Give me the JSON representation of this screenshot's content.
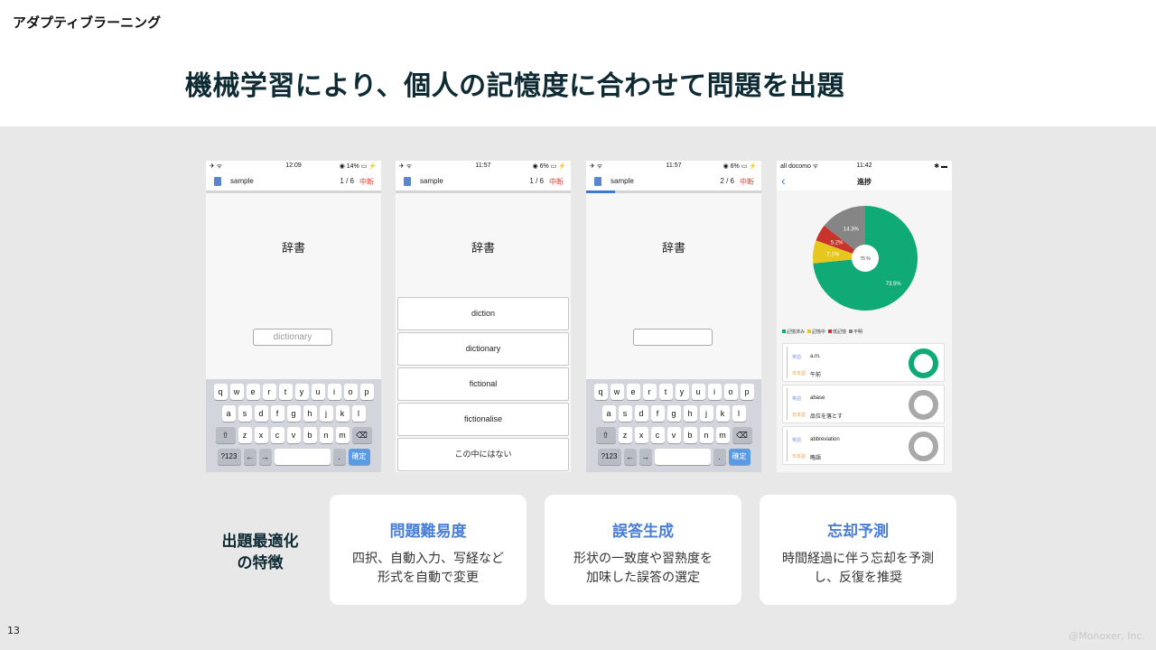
{
  "slide": {
    "section_label": "アダプティブラーニング",
    "headline": "機械学習により、個人の記憶度に合わせて問題を出題",
    "page_number": "13",
    "copyright": "@Monoxer, Inc."
  },
  "keyboard": {
    "row1": [
      "q",
      "w",
      "e",
      "r",
      "t",
      "y",
      "u",
      "i",
      "o",
      "p"
    ],
    "row2": [
      "a",
      "s",
      "d",
      "f",
      "g",
      "h",
      "j",
      "k",
      "l"
    ],
    "row3_shift": "⇧",
    "row3": [
      "z",
      "x",
      "c",
      "v",
      "b",
      "n",
      "m"
    ],
    "row3_delete": "⌫",
    "num": "?123",
    "left": "←",
    "right": "→",
    "dot": ".",
    "ok": "確定"
  },
  "phones": {
    "p1": {
      "status_left": "✈ ᯤ",
      "status_time": "12:09",
      "status_right": "◉ 14% ▭ ⚡",
      "deck": "sample",
      "count": "1 / 6",
      "quit": "中断",
      "progress": 0.0,
      "word": "辞書",
      "answer": "dictionary"
    },
    "p2": {
      "status_left": "✈ ᯤ",
      "status_time": "11:57",
      "status_right": "◉ 6% ▭ ⚡",
      "deck": "sample",
      "count": "1 / 6",
      "quit": "中断",
      "progress": 0.0,
      "word": "辞書",
      "choices": [
        "diction",
        "dictionary",
        "fictional",
        "fictionalise",
        "この中にはない"
      ]
    },
    "p3": {
      "status_left": "✈ ᯤ",
      "status_time": "11:57",
      "status_right": "◉ 6% ▭ ⚡",
      "deck": "sample",
      "count": "2 / 6",
      "quit": "中断",
      "progress": 0.167,
      "word": "辞書",
      "answer": ""
    },
    "p4": {
      "status_left": "all docomo ᯤ",
      "status_time": "11:42",
      "status_right": "✱ ▬",
      "title": "進捗",
      "back": "‹",
      "pie": {
        "center_label": "75 %",
        "slices": [
          {
            "label": "73.5%",
            "value": 73.5,
            "color": "#0faa76"
          },
          {
            "label": "7.1%",
            "value": 7.1,
            "color": "#e6c71e"
          },
          {
            "label": "5.2%",
            "value": 5.2,
            "color": "#c8332b"
          },
          {
            "label": "14.3%",
            "value": 14.3,
            "color": "#858585"
          }
        ]
      },
      "legend": [
        {
          "label": "記憶済み",
          "color": "#0faa76"
        },
        {
          "label": "記憶中",
          "color": "#e6c71e"
        },
        {
          "label": "低記憶",
          "color": "#c8332b"
        },
        {
          "label": "不明",
          "color": "#858585"
        }
      ],
      "cards": [
        {
          "tag_en": "英語",
          "en": "a.m.",
          "tag_jp": "日本語",
          "jp": "午前",
          "ring_color": "#0faa76"
        },
        {
          "tag_en": "英語",
          "en": "abase",
          "tag_jp": "日本語",
          "jp": "品位を落とす",
          "ring_color": "#a9a9a9"
        },
        {
          "tag_en": "英語",
          "en": "abbreviation",
          "tag_jp": "日本語",
          "jp": "略語",
          "ring_color": "#a9a9a9"
        }
      ]
    }
  },
  "features": {
    "heading_line1": "出題最適化",
    "heading_line2": "の特徴",
    "items": [
      {
        "title": "問題難易度",
        "line1": "四択、自動入力、写経など",
        "line2": "形式を自動で変更"
      },
      {
        "title": "誤答生成",
        "line1": "形状の一致度や習熟度を",
        "line2": "加味した誤答の選定"
      },
      {
        "title": "忘却予測",
        "line1": "時間経過に伴う忘却を予測",
        "line2": "し、反復を推奨"
      }
    ]
  }
}
